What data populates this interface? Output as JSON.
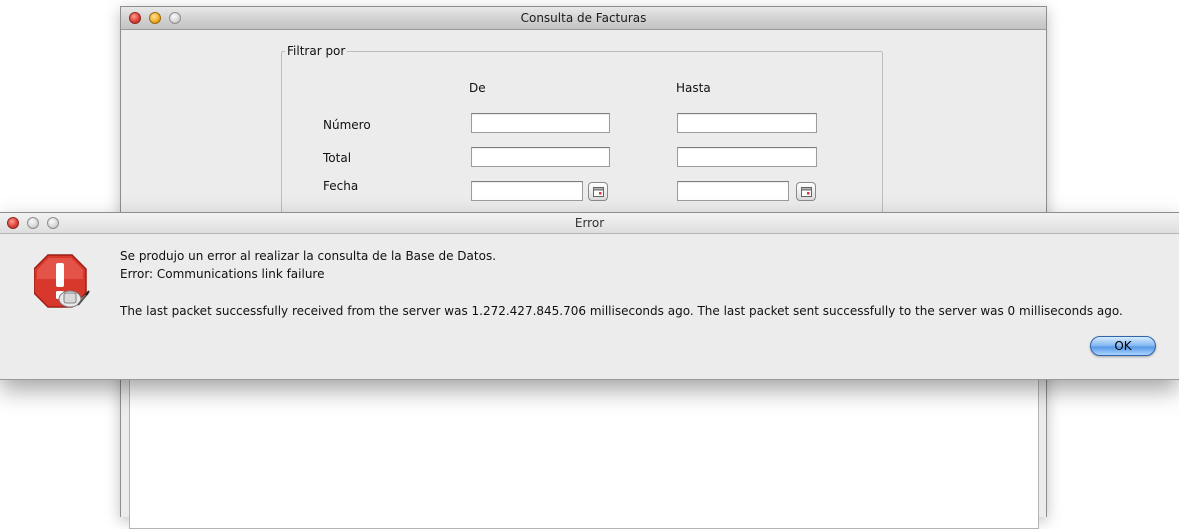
{
  "main_window": {
    "title": "Consulta de Facturas",
    "filter": {
      "legend": "Filtrar por",
      "col_from": "De",
      "col_to": "Hasta",
      "rows": {
        "numero": "Número",
        "total": "Total",
        "fecha": "Fecha"
      }
    }
  },
  "error_dialog": {
    "title": "Error",
    "line1": "Se produjo un error al realizar la consulta de la Base de Datos.",
    "line2": "Error: Communications link failure",
    "line3": "The last packet successfully received from the server was 1.272.427.845.706 milliseconds ago.  The last packet sent successfully to the server was 0 milliseconds ago.",
    "ok_label": "OK"
  },
  "icons": {
    "error_icon": "stop-sign-warning-icon",
    "calendar_icon": "calendar-icon"
  },
  "colors": {
    "window_bg": "#ececec",
    "close_red": "#e0443a",
    "minimize_yellow": "#f2b12c",
    "ok_button_blue": "#5797e6",
    "error_icon_red": "#d8382c"
  }
}
